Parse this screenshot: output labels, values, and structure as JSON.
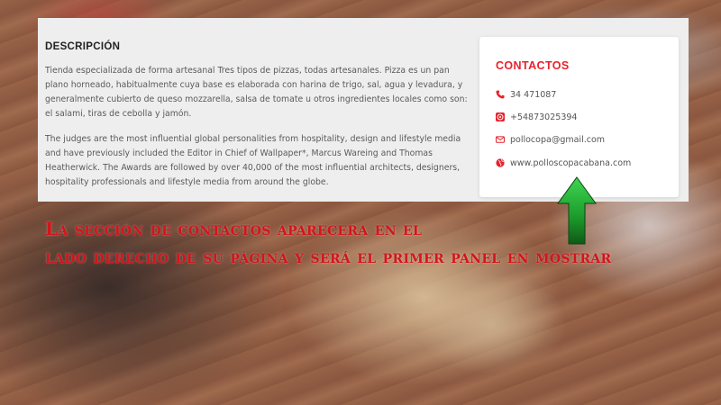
{
  "description": {
    "title": "DESCRIPCIÓN",
    "paragraph1": "Tienda especializada de forma artesanal Tres tipos de pizzas, todas artesanales. Pizza es un pan plano horneado, habitualmente cuya base es elaborada con harina de trigo, sal, agua y levadura, y generalmente cubierto de queso mozzarella, salsa de tomate u otros ingredientes locales como son: el salami, tiras de cebolla y jamón.",
    "paragraph2": "The judges are the most influential global personalities from hospitality, design and lifestyle media and have previously included the Editor in Chief of Wallpaper*, Marcus Wareing and Thomas Heatherwick. The Awards are followed by over 40,000 of the most influential architects, designers, hospitality professionals and lifestyle media from around the globe."
  },
  "contacts": {
    "title": "CONTACTOS",
    "items": [
      {
        "icon": "phone-icon",
        "text": "34 471087"
      },
      {
        "icon": "whatsapp-icon",
        "text": "+54873025394"
      },
      {
        "icon": "mail-icon",
        "text": "pollocopa@gmail.com"
      },
      {
        "icon": "globe-icon",
        "text": "www.polloscopacabana.com"
      }
    ]
  },
  "caption": {
    "line1": "La sección de contactos aparecera en el",
    "line2": "lado derecho de su página y será el primer panel en mostrar"
  },
  "colors": {
    "accent": "#e8212b",
    "caption": "#d4141a",
    "arrow": "#1f9a2e"
  }
}
